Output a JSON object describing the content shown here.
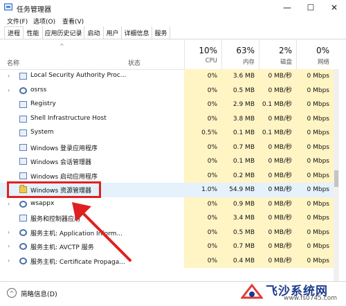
{
  "window": {
    "title": "任务管理器",
    "controls": {
      "minimize": "—",
      "maximize": "☐",
      "close": "✕"
    }
  },
  "menu": [
    "文件(F)",
    "选项(O)",
    "查看(V)"
  ],
  "tabs": [
    "进程",
    "性能",
    "应用历史记录",
    "启动",
    "用户",
    "详细信息",
    "服务"
  ],
  "header": {
    "sort_glyph": "^",
    "name": "名称",
    "status": "状态",
    "cpu": {
      "pct": "10%",
      "label": "CPU"
    },
    "mem": {
      "pct": "63%",
      "label": "内存"
    },
    "disk": {
      "pct": "2%",
      "label": "磁盘"
    },
    "net": {
      "pct": "0%",
      "label": "网络"
    }
  },
  "rows": [
    {
      "name": "Local Security Authority Proc...",
      "cpu": "0%",
      "mem": "3.6 MB",
      "disk": "0 MB/秒",
      "net": "0 Mbps",
      "expand": true,
      "icon": "window-icon"
    },
    {
      "name": "osrss",
      "cpu": "0%",
      "mem": "0.5 MB",
      "disk": "0 MB/秒",
      "net": "0 Mbps",
      "expand": true,
      "icon": "gear-icon"
    },
    {
      "name": "Registry",
      "cpu": "0%",
      "mem": "2.9 MB",
      "disk": "0.1 MB/秒",
      "net": "0 Mbps",
      "expand": false,
      "icon": "window-icon"
    },
    {
      "name": "Shell Infrastructure Host",
      "cpu": "0%",
      "mem": "3.8 MB",
      "disk": "0 MB/秒",
      "net": "0 Mbps",
      "expand": false,
      "icon": "window-icon"
    },
    {
      "name": "System",
      "cpu": "0.5%",
      "mem": "0.1 MB",
      "disk": "0.1 MB/秒",
      "net": "0 Mbps",
      "expand": false,
      "icon": "window-icon"
    },
    {
      "name": "Windows 登录应用程序",
      "cpu": "0%",
      "mem": "0.7 MB",
      "disk": "0 MB/秒",
      "net": "0 Mbps",
      "expand": false,
      "icon": "window-icon"
    },
    {
      "name": "Windows 会话管理器",
      "cpu": "0%",
      "mem": "0.1 MB",
      "disk": "0 MB/秒",
      "net": "0 Mbps",
      "expand": false,
      "icon": "window-icon"
    },
    {
      "name": "Windows 启动应用程序",
      "cpu": "0%",
      "mem": "0.2 MB",
      "disk": "0 MB/秒",
      "net": "0 Mbps",
      "expand": false,
      "icon": "window-icon"
    },
    {
      "name": "Windows 资源管理器",
      "cpu": "1.0%",
      "mem": "54.9 MB",
      "disk": "0 MB/秒",
      "net": "0 Mbps",
      "expand": false,
      "icon": "folder-icon"
    },
    {
      "name": "wsappx",
      "cpu": "0%",
      "mem": "0.9 MB",
      "disk": "0 MB/秒",
      "net": "0 Mbps",
      "expand": true,
      "icon": "gear-icon"
    },
    {
      "name": "服务和控制器应用",
      "cpu": "0%",
      "mem": "3.4 MB",
      "disk": "0 MB/秒",
      "net": "0 Mbps",
      "expand": false,
      "icon": "window-icon"
    },
    {
      "name": "服务主机: Application Inform...",
      "cpu": "0%",
      "mem": "0.5 MB",
      "disk": "0 MB/秒",
      "net": "0 Mbps",
      "expand": true,
      "icon": "gear-icon"
    },
    {
      "name": "服务主机: AVCTP 服务",
      "cpu": "0%",
      "mem": "0.7 MB",
      "disk": "0 MB/秒",
      "net": "0 Mbps",
      "expand": true,
      "icon": "gear-icon"
    },
    {
      "name": "服务主机: Certificate Propaga...",
      "cpu": "0%",
      "mem": "0.4 MB",
      "disk": "0 MB/秒",
      "net": "0 Mbps",
      "expand": true,
      "icon": "gear-icon"
    }
  ],
  "footer": {
    "label": "简略信息(D)",
    "glyph": "^"
  },
  "watermark": {
    "title": "飞沙系统网",
    "url": "www.fs0745.com"
  },
  "colors": {
    "highlight": "#e02020",
    "heat": "#fff4c4",
    "selected": "#e5f1fb"
  }
}
